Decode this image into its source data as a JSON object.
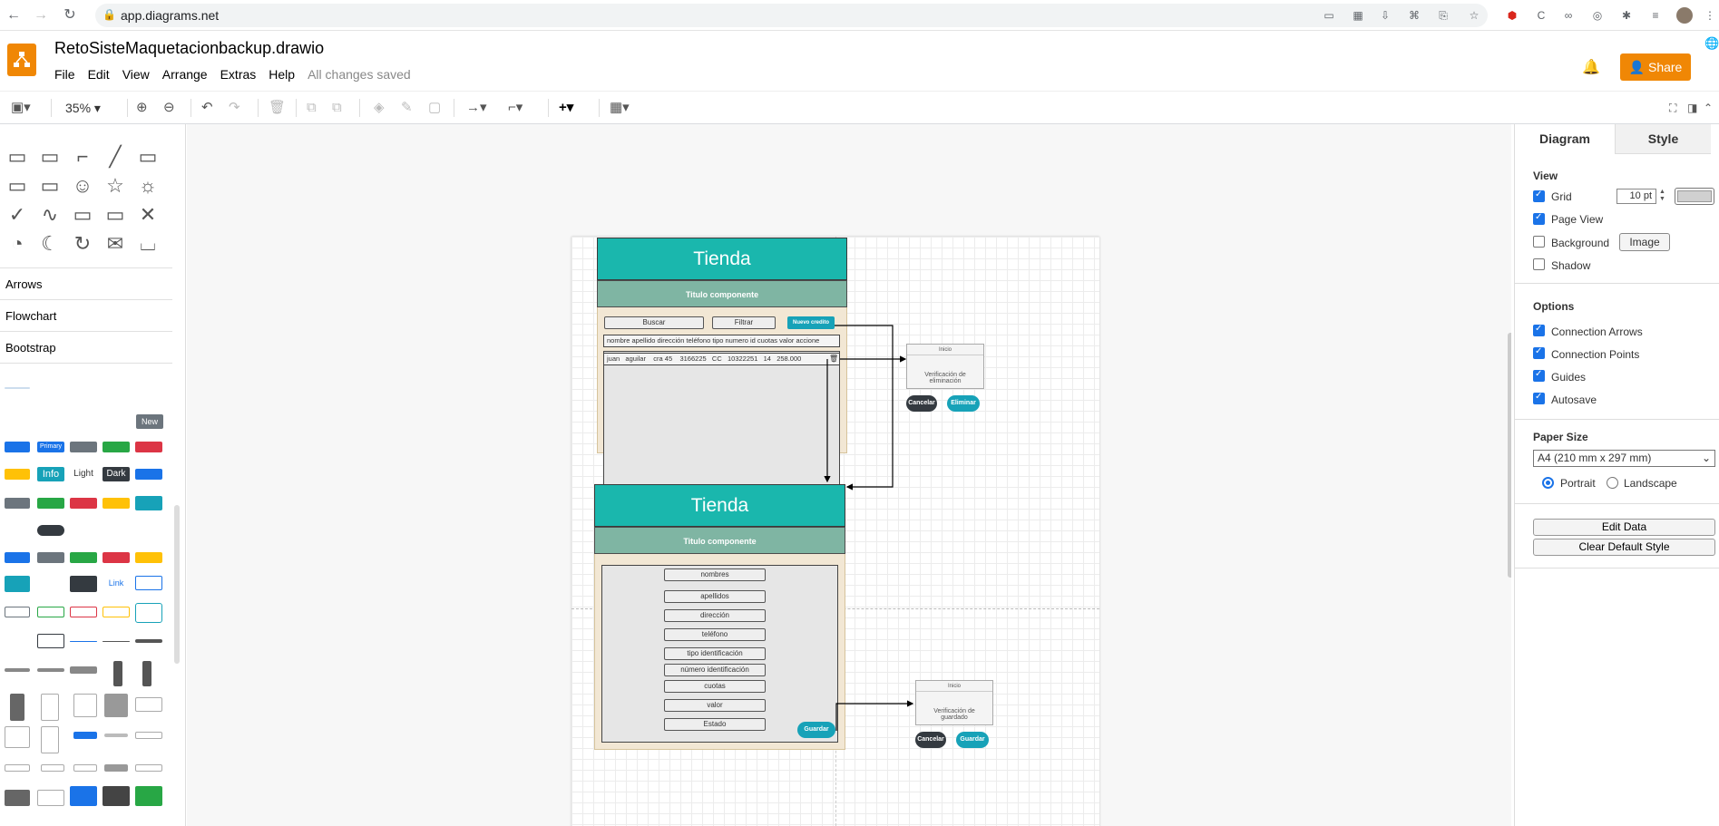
{
  "browser": {
    "url": "app.diagrams.net"
  },
  "app": {
    "doc_title": "RetoSisteMaquetacionbackup.drawio",
    "menu": [
      "File",
      "Edit",
      "View",
      "Arrange",
      "Extras",
      "Help"
    ],
    "save_status": "All changes saved",
    "share_label": "Share"
  },
  "toolbar": {
    "zoom": "35%"
  },
  "sidebar": {
    "categories": [
      "Arrows",
      "Flowchart",
      "Bootstrap"
    ],
    "bootstrap_labels": {
      "new": "New",
      "primary": "Primary",
      "info": "Info",
      "light": "Light",
      "dark": "Dark",
      "link": "Link"
    }
  },
  "diagram": {
    "top": {
      "header": "Tienda",
      "subtitle": "Titulo componente",
      "buscar": "Buscar",
      "filtrar": "Filtrar",
      "nuevo": "Nuevo credito",
      "columns": "nombre apellido dirección teléfono tipo numero id cuotas valor accione",
      "row": "juan   aguilar    cra 45    3166225   CC   10322251   14   258.000"
    },
    "delete_dialog": {
      "title": "Inicio",
      "text": "Verificación de eliminación",
      "cancel": "Cancelar",
      "confirm": "Eliminar"
    },
    "bottom": {
      "header": "Tienda",
      "subtitle": "Titulo componente",
      "fields": [
        "nombres",
        "apellidos",
        "dirección",
        "teléfono",
        "tipo identificación",
        "número identificación",
        "cuotas",
        "valor",
        "Estado"
      ],
      "save": "Guardar"
    },
    "save_dialog": {
      "title": "Inicio",
      "text": "Verificación de guardado",
      "cancel": "Cancelar",
      "confirm": "Guardar"
    }
  },
  "panel": {
    "tabs": [
      "Diagram",
      "Style"
    ],
    "view_title": "View",
    "view": [
      {
        "label": "Grid",
        "checked": true
      },
      {
        "label": "Page View",
        "checked": true
      },
      {
        "label": "Background",
        "checked": false
      },
      {
        "label": "Shadow",
        "checked": false
      }
    ],
    "grid_size": "10 pt",
    "image_btn": "Image",
    "options_title": "Options",
    "options": [
      {
        "label": "Connection Arrows",
        "checked": true
      },
      {
        "label": "Connection Points",
        "checked": true
      },
      {
        "label": "Guides",
        "checked": true
      },
      {
        "label": "Autosave",
        "checked": true
      }
    ],
    "paper_title": "Paper Size",
    "paper": "A4 (210 mm x 297 mm)",
    "portrait": "Portrait",
    "landscape": "Landscape",
    "edit_data": "Edit Data",
    "clear_style": "Clear Default Style"
  },
  "colors": {
    "accent": "#f08705",
    "teal": "#1ab7ad",
    "subheader": "#7fb5a3",
    "blue": "#1a73e8"
  }
}
